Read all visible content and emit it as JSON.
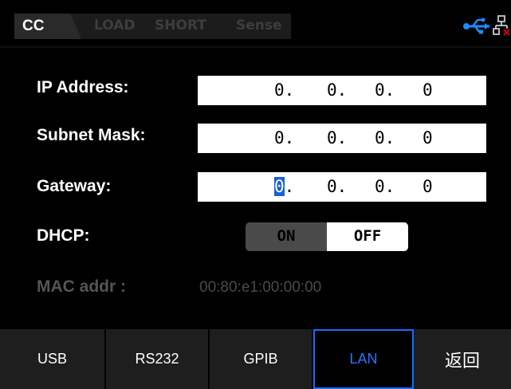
{
  "header": {
    "mode_active": "CC",
    "modes_inactive": [
      "LOAD",
      "SHORT",
      "Sense"
    ],
    "icons": [
      "usb-connection-icon",
      "lan-network-icon"
    ]
  },
  "form": {
    "ip_label": "IP Address:",
    "ip": [
      "0.",
      "0.",
      "0.",
      "0"
    ],
    "mask_label": "Subnet Mask:",
    "mask": [
      "0.",
      "0.",
      "0.",
      "0"
    ],
    "gateway_label": "Gateway:",
    "gateway": [
      "0",
      ".",
      "0.",
      "0.",
      "0"
    ],
    "dhcp_label": "DHCP:",
    "dhcp_on": "ON",
    "dhcp_off": "OFF",
    "mac_label": "MAC addr :",
    "mac_value": "00:80:e1:00:00:00"
  },
  "softkeys": [
    "USB",
    "RS232",
    "GPIB",
    "LAN",
    "返回"
  ],
  "colors": {
    "accent": "#1a6cff",
    "cursor": "#1a60d6",
    "background": "#000000"
  }
}
